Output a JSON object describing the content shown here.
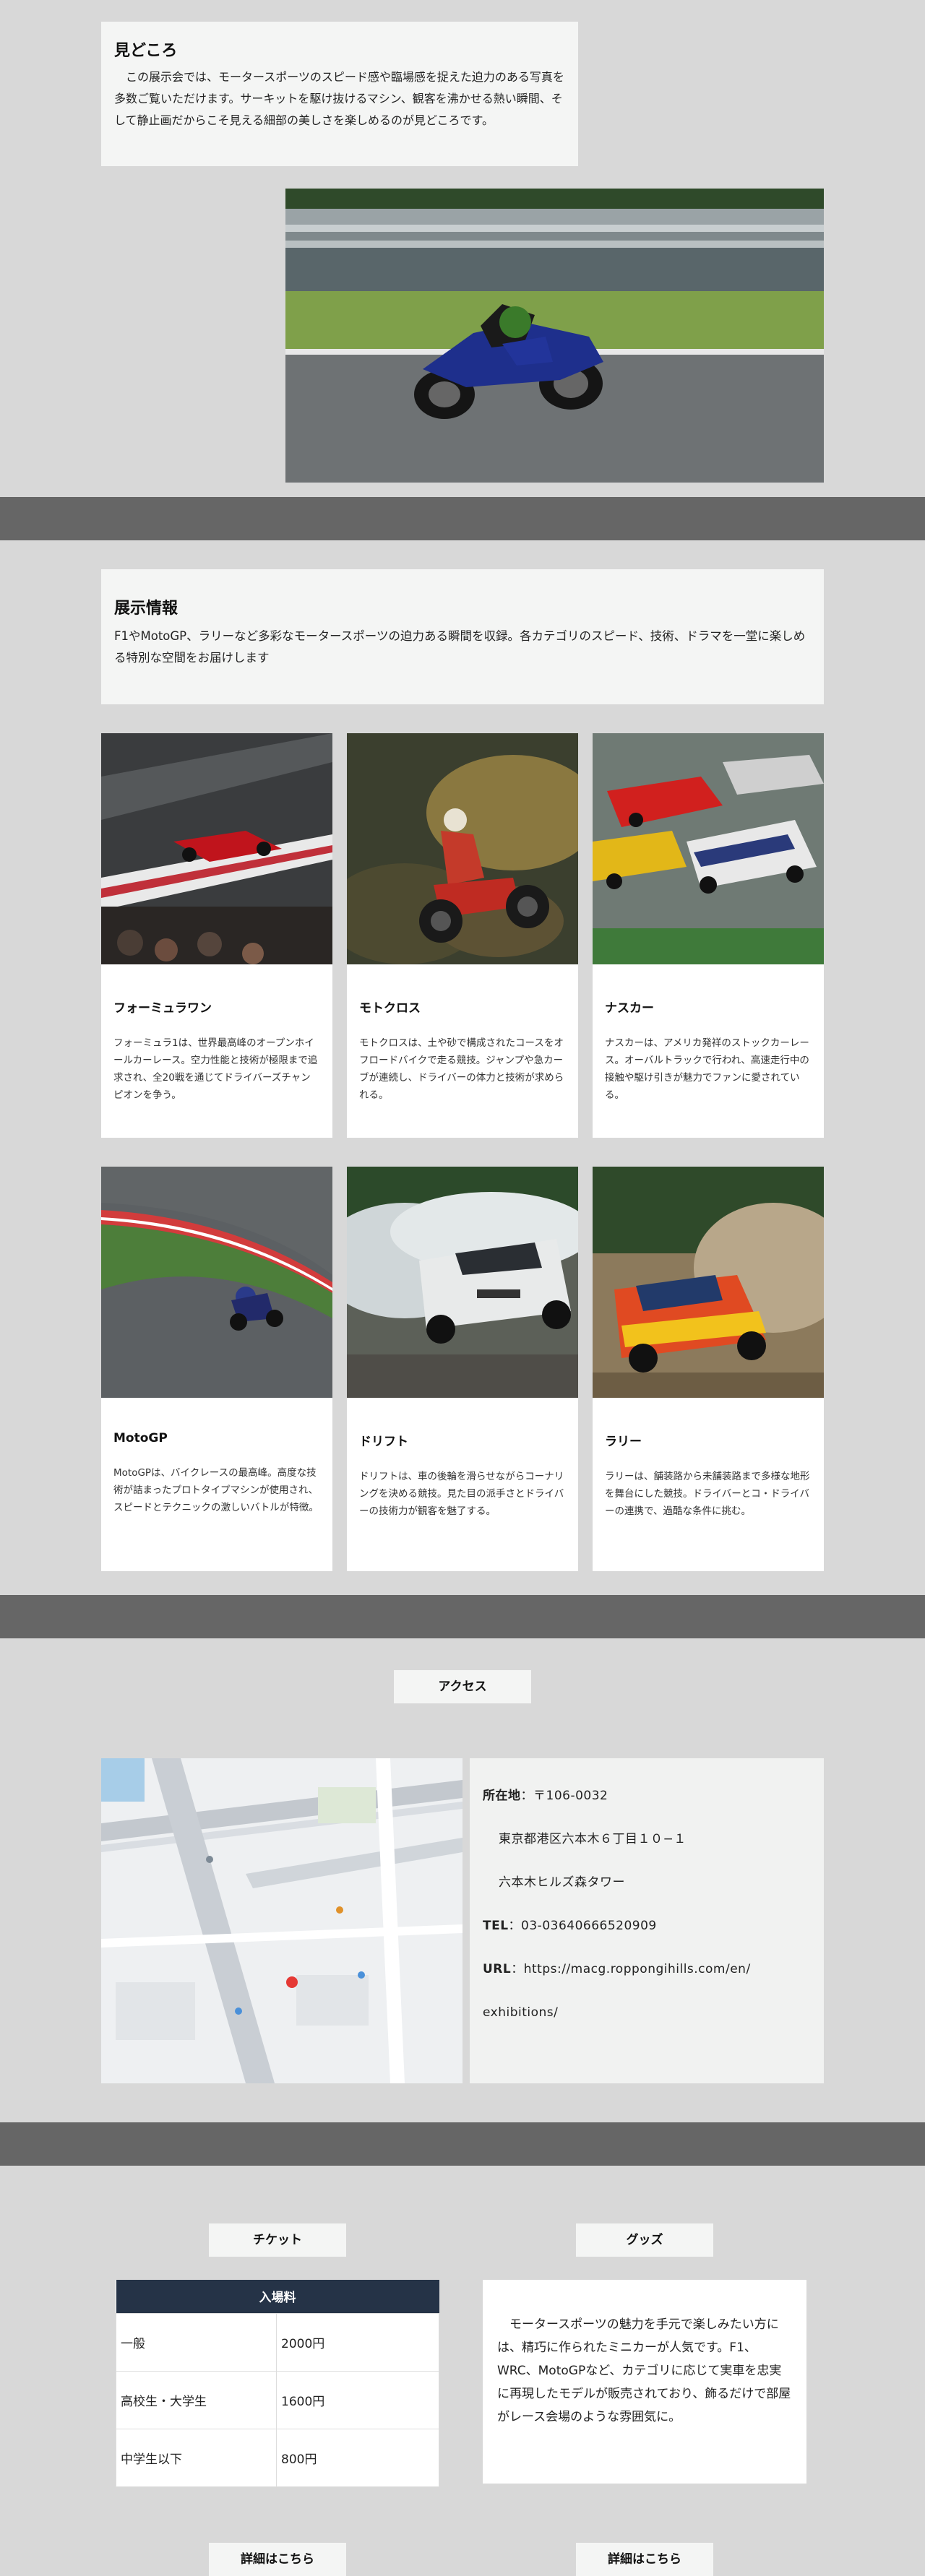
{
  "highlight": {
    "title": "見どころ",
    "text": "この展示会では、モータースポーツのスピード感や臨場感を捉えた迫力のある写真を多数ご覧いただけます。サーキットを駆け抜けるマシン、観客を沸かせる熱い瞬間、そして静止画だからこそ見える細部の美しさを楽しめるのが見どころです。"
  },
  "exhibit": {
    "title": "展示情報",
    "text": "F1やMotoGP、ラリーなど多彩なモータースポーツの迫力ある瞬間を収録。各カテゴリのスピード、技術、ドラマを一堂に楽しめる特別な空間をお届けします",
    "cards": [
      {
        "title": "フォーミュラワン",
        "text": "フォーミュラ1は、世界最高峰のオープンホイールカーレース。空力性能と技術が極限まで追求され、全20戦を通じてドライバーズチャンピオンを争う。"
      },
      {
        "title": "モトクロス",
        "text": "モトクロスは、土や砂で構成されたコースをオフロードバイクで走る競技。ジャンプや急カーブが連続し、ドライバーの体力と技術が求められる。"
      },
      {
        "title": "ナスカー",
        "text": "ナスカーは、アメリカ発祥のストックカーレース。オーバルトラックで行われ、高速走行中の接触や駆け引きが魅力でファンに愛されている。"
      },
      {
        "title": "MotoGP",
        "text": "MotoGPは、バイクレースの最高峰。高度な技術が詰まったプロトタイプマシンが使用され、スピードとテクニックの激しいバトルが特徴。"
      },
      {
        "title": "ドリフト",
        "text": "ドリフトは、車の後輪を滑らせながらコーナリングを決める競技。見た目の派手さとドライバーの技術力が観客を魅了する。"
      },
      {
        "title": "ラリー",
        "text": "ラリーは、舗装路から未舗装路まで多様な地形を舞台にした競技。ドライバーとコ・ドライバーの連携で、過酷な条件に挑む。"
      }
    ]
  },
  "access": {
    "button": "アクセス",
    "address_label": "所在地",
    "postal": "〒106-0032",
    "address1": "東京都港区六本木６丁目１０−１",
    "address2": "六本木ヒルズ森タワー",
    "tel_label": "TEL",
    "tel": "03-03640666520909",
    "url_label": "URL",
    "url1": "https://macg.roppongihills.com/en/",
    "url2": "exhibitions/"
  },
  "ticket": {
    "button": "チケット",
    "header": "入場料",
    "rows": [
      {
        "type": "一般",
        "price": "2000円"
      },
      {
        "type": "高校生・大学生",
        "price": "1600円"
      },
      {
        "type": "中学生以下",
        "price": "800円"
      }
    ],
    "detail": "詳細はこちら"
  },
  "goods": {
    "button": "グッズ",
    "text": "モータースポーツの魅力を手元で楽しみたい方には、精巧に作られたミニカーが人気です。F1、WRC、MotoGPなど、カテゴリに応じて実車を忠実に再現したモデルが販売されており、飾るだけで部屋がレース会場のような雰囲気に。",
    "detail": "詳細はこちら"
  },
  "colors": {
    "page_bg": "#d8d8d8",
    "band": "#666666",
    "box": "#f4f5f4",
    "table_header": "#253347"
  }
}
